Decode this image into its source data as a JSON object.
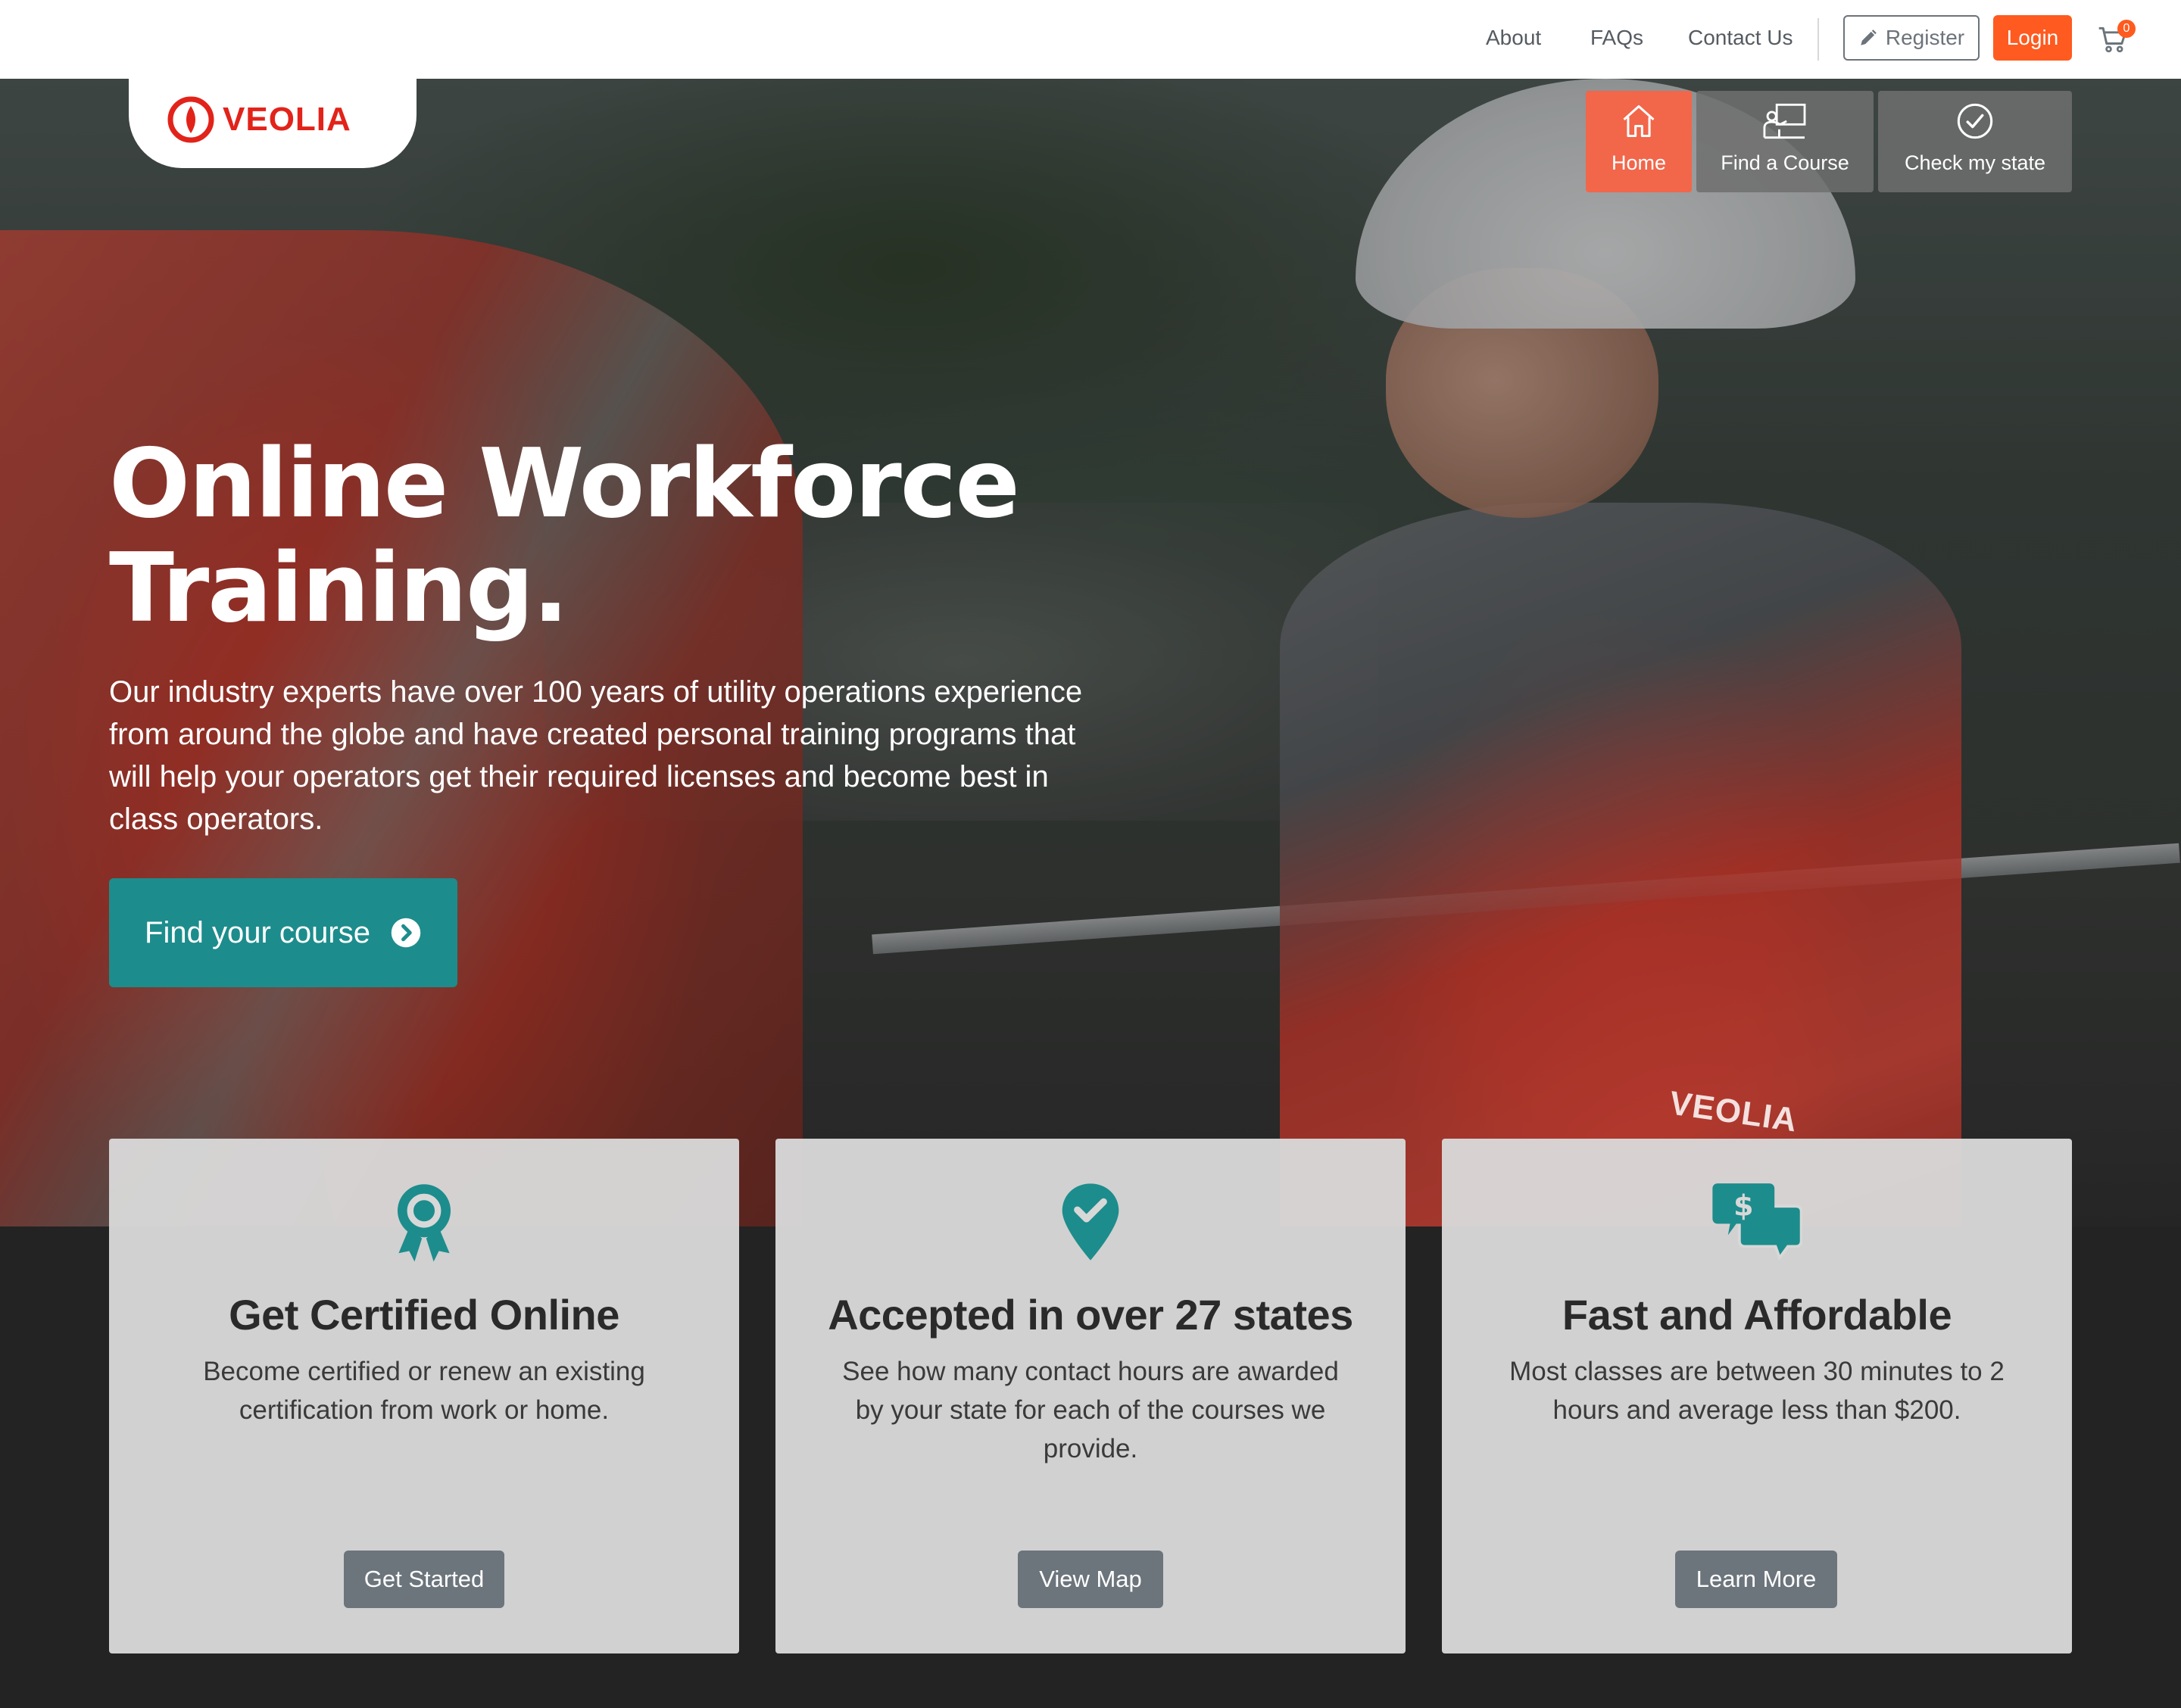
{
  "topnav": {
    "links": [
      "About",
      "FAQs",
      "Contact Us"
    ],
    "register_label": "Register",
    "login_label": "Login",
    "cart_count": "0"
  },
  "logo": {
    "text": "VEOLIA"
  },
  "hero_nav": {
    "home": "Home",
    "find_course": "Find a Course",
    "check_state": "Check my state"
  },
  "hero": {
    "title_line1": "Online Workforce",
    "title_line2": "Training.",
    "description": "Our industry experts have over 100 years of utility operations experience from around the globe and have created personal training programs that will help your operators get their required licenses and become best in class operators.",
    "cta_label": "Find your course",
    "jacket_logo": "VEOLIA"
  },
  "cards": [
    {
      "icon": "award-ribbon-icon",
      "title": "Get Certified Online",
      "text": "Become certified or renew an existing certification from work or home.",
      "button": "Get Started"
    },
    {
      "icon": "map-marker-check-icon",
      "title": "Accepted in over 27 states",
      "text": "See how many contact hours are awarded by your state for each of the courses we provide.",
      "button": "View Map"
    },
    {
      "icon": "dollar-chat-icon",
      "title": "Fast and Affordable",
      "text": "Most classes are between 30 minutes to 2 hours and average less than $200.",
      "button": "Learn More"
    }
  ],
  "colors": {
    "accent_orange": "#ff5a1f",
    "tile_home": "#f2664a",
    "teal": "#1d8c8c",
    "logo_red": "#e2231a",
    "footer_dark": "#232323"
  }
}
